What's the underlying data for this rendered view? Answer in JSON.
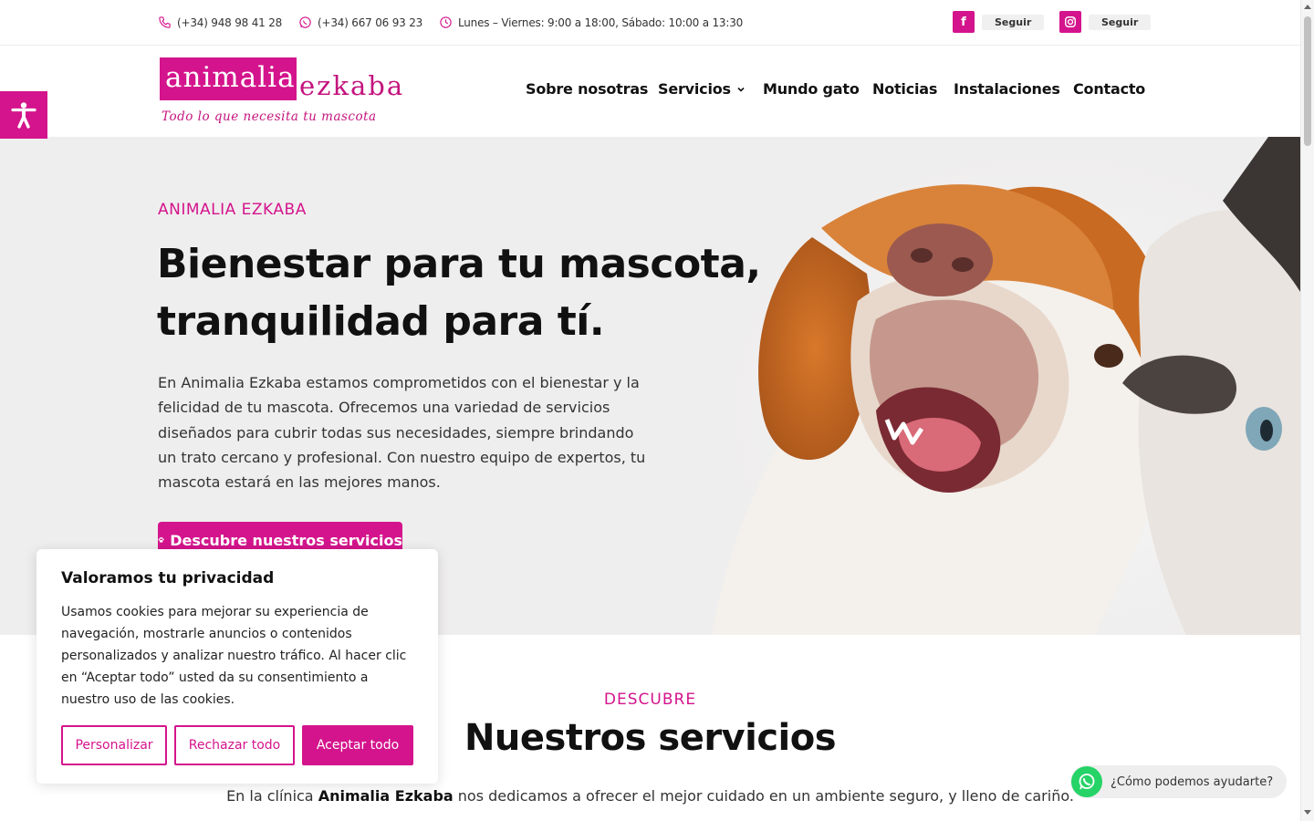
{
  "topbar": {
    "phone": "(+34) 948 98 41 28",
    "whatsapp": "(+34) 667 06 93 23",
    "hours": "Lunes – Viernes: 9:00 a 18:00, Sábado: 10:00 a 13:30",
    "facebook": {
      "icon": "facebook-icon",
      "label": "Seguir"
    },
    "instagram": {
      "icon": "instagram-icon",
      "label": "Seguir"
    }
  },
  "logo": {
    "word1": "animalia",
    "word2": "ezkaba",
    "tagline": "Todo lo que necesita tu mascota"
  },
  "nav": {
    "items": [
      "Sobre nosotras",
      "Servicios",
      "Mundo gato",
      "Noticias",
      "Instalaciones",
      "Contacto"
    ]
  },
  "hero": {
    "eyebrow": "ANIMALIA EZKABA",
    "title": "Bienestar para tu mascota, tranquilidad para tí.",
    "body": "En Animalia Ezkaba estamos comprometidos con el bienestar y la felicidad de tu mascota. Ofrecemos una variedad de servicios diseñados para cubrir todas sus necesidades, siempre brindando un trato cercano y profesional. Con nuestro equipo de expertos, tu mascota estará en las mejores manos.",
    "button": "Descubre nuestros servicios"
  },
  "services": {
    "eyebrow": "DESCUBRE",
    "title": "Nuestros servicios",
    "text_pre": "En la clínica ",
    "text_bold": "Animalia Ezkaba",
    "text_post": " nos dedicamos a ofrecer el mejor cuidado en un ambiente seguro, y lleno de cariño."
  },
  "cookie": {
    "title": "Valoramos tu privacidad",
    "text": "Usamos cookies para mejorar su experiencia de navegación, mostrarle anuncios o contenidos personalizados y analizar nuestro tráfico. Al hacer clic en “Aceptar todo” usted da su consentimiento a nuestro uso de las cookies.",
    "customize": "Personalizar",
    "reject": "Rechazar todo",
    "accept": "Aceptar todo"
  },
  "whatsapp_widget": {
    "label": "¿Cómo podemos ayudarte?"
  },
  "colors": {
    "brand": "#d4148c",
    "whatsapp": "#25d366"
  }
}
